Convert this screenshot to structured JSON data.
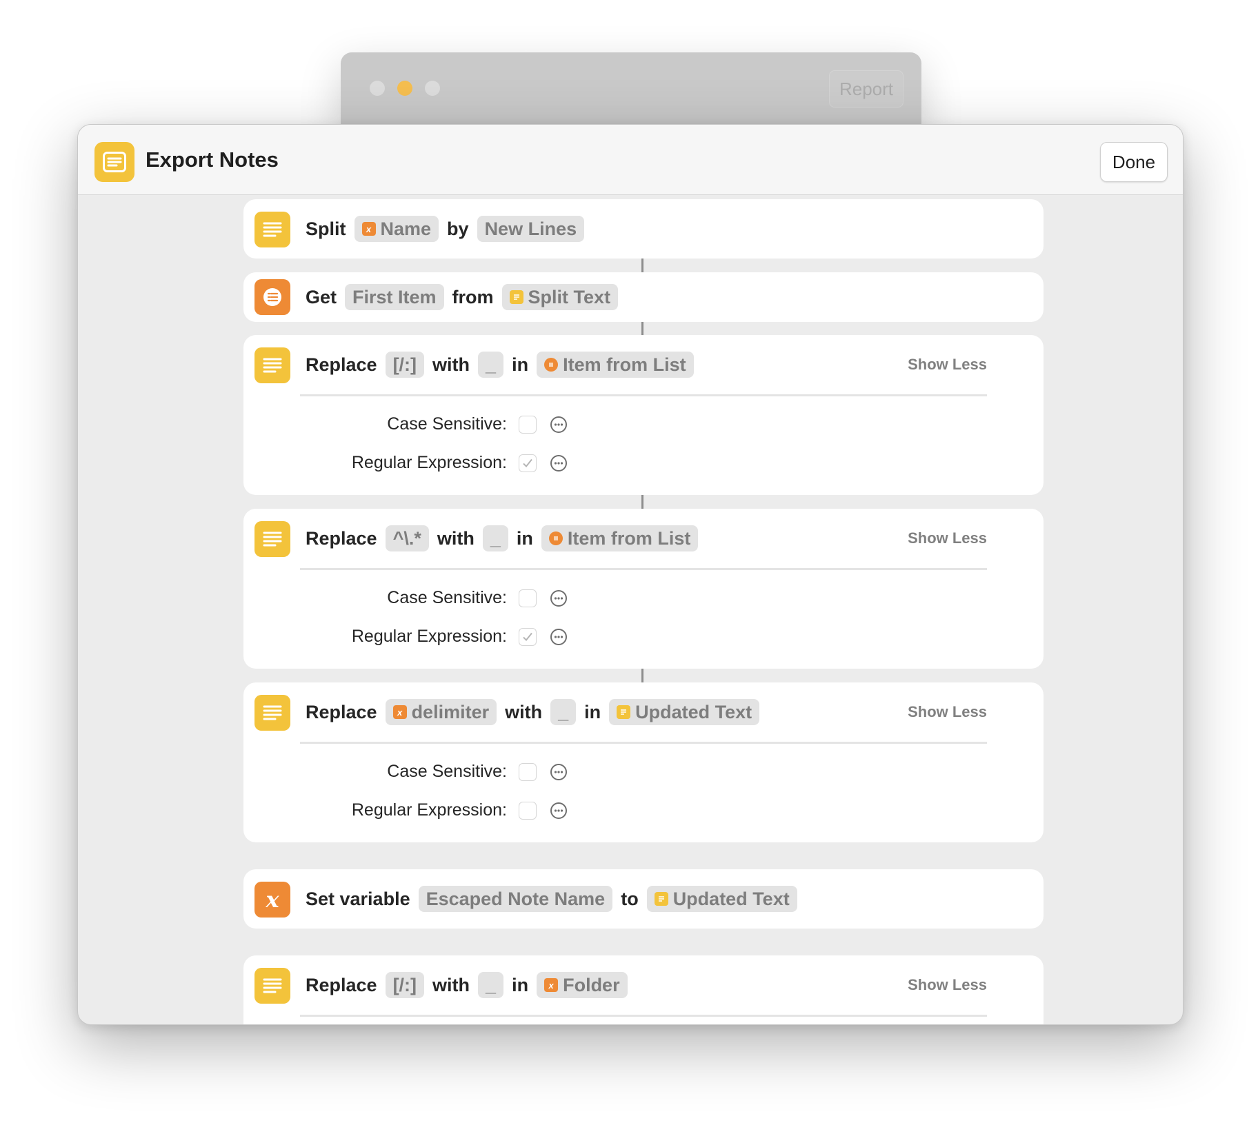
{
  "background_window": {
    "report_label": "Report"
  },
  "sheet": {
    "title": "Export Notes",
    "done_label": "Done"
  },
  "actions": [
    {
      "kind": "split",
      "words": {
        "split": "Split",
        "by": "by"
      },
      "input": "Name",
      "separator": "New Lines"
    },
    {
      "kind": "get-item",
      "words": {
        "get": "Get",
        "from": "from"
      },
      "item": "First Item",
      "list": "Split Text"
    },
    {
      "kind": "replace",
      "words": {
        "replace": "Replace",
        "with": "with",
        "in": "in"
      },
      "find": "[/:]",
      "replacement": "_",
      "source": "Item from List",
      "toggle": "Show Less",
      "case_label": "Case Sensitive:",
      "case_checked": false,
      "regex_label": "Regular Expression:",
      "regex_checked": true
    },
    {
      "kind": "replace",
      "words": {
        "replace": "Replace",
        "with": "with",
        "in": "in"
      },
      "find": "^\\.*",
      "replacement": "_",
      "source": "Item from List",
      "toggle": "Show Less",
      "case_label": "Case Sensitive:",
      "case_checked": false,
      "regex_label": "Regular Expression:",
      "regex_checked": true
    },
    {
      "kind": "replace",
      "words": {
        "replace": "Replace",
        "with": "with",
        "in": "in"
      },
      "find": "delimiter",
      "replacement": "_",
      "source": "Updated Text",
      "toggle": "Show Less",
      "case_label": "Case Sensitive:",
      "case_checked": false,
      "regex_label": "Regular Expression:",
      "regex_checked": false
    },
    {
      "kind": "set-variable",
      "words": {
        "set": "Set variable",
        "to": "to"
      },
      "variable": "Escaped Note Name",
      "value": "Updated Text"
    },
    {
      "kind": "replace",
      "words": {
        "replace": "Replace",
        "with": "with",
        "in": "in"
      },
      "find": "[/:]",
      "replacement": "_",
      "source": "Folder",
      "toggle": "Show Less"
    }
  ],
  "icons": {
    "text_action": "text-lines-icon",
    "list_action": "list-icon",
    "variable_action": "variable-x-icon",
    "variable_token": "variable-x-icon",
    "more": "ellipsis-circle-icon",
    "check": "checkmark-icon"
  },
  "colors": {
    "yellow": "#f3c33b",
    "orange": "#ee8a35",
    "token_bg": "#e3e3e3",
    "sheet_bg": "#ececec"
  }
}
